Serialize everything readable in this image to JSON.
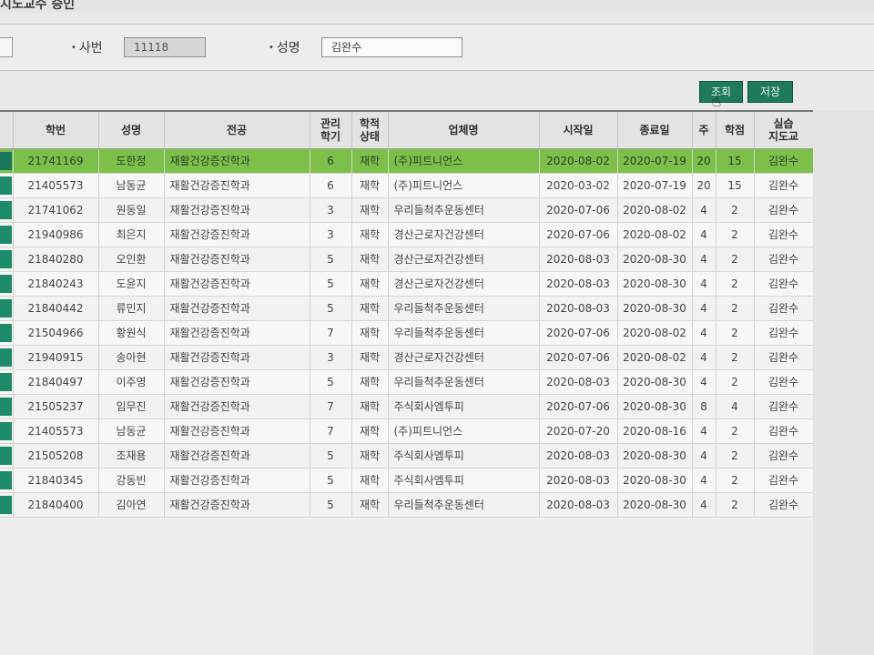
{
  "window": {
    "title": "지도교수 승인"
  },
  "search": {
    "id_label": "사번",
    "id_value": "11118",
    "name_label": "성명",
    "name_value": "김완수"
  },
  "toolbar": {
    "search_label": "조회",
    "save_label": "저장"
  },
  "colors": {
    "button": "#1e7a58",
    "selected_row": "#7cc04a",
    "indicator": "#1d8a6a"
  },
  "table": {
    "headers": {
      "student_id": "학번",
      "name": "성명",
      "major": "전공",
      "semester_1": "관리",
      "semester_2": "학기",
      "status_1": "학적",
      "status_2": "상태",
      "company": "업체명",
      "start": "시작일",
      "end": "종료일",
      "weeks": "주",
      "credits": "학점",
      "advisor_1": "실습",
      "advisor_2": "지도교"
    },
    "rows": [
      {
        "student_id": "21741169",
        "name": "도한정",
        "major": "재활건강증진학과",
        "semester": "6",
        "status": "재학",
        "company": "(주)피트니언스",
        "start": "2020-08-02",
        "end": "2020-07-19",
        "weeks": "20",
        "credits": "15",
        "advisor": "김완수"
      },
      {
        "student_id": "21405573",
        "name": "남동균",
        "major": "재활건강증진학과",
        "semester": "6",
        "status": "재학",
        "company": "(주)피트니언스",
        "start": "2020-03-02",
        "end": "2020-07-19",
        "weeks": "20",
        "credits": "15",
        "advisor": "김완수"
      },
      {
        "student_id": "21741062",
        "name": "원동일",
        "major": "재활건강증진학과",
        "semester": "3",
        "status": "재학",
        "company": "우리들척추운동센터",
        "start": "2020-07-06",
        "end": "2020-08-02",
        "weeks": "4",
        "credits": "2",
        "advisor": "김완수"
      },
      {
        "student_id": "21940986",
        "name": "최은지",
        "major": "재활건강증진학과",
        "semester": "3",
        "status": "재학",
        "company": "경산근로자건강센터",
        "start": "2020-07-06",
        "end": "2020-08-02",
        "weeks": "4",
        "credits": "2",
        "advisor": "김완수"
      },
      {
        "student_id": "21840280",
        "name": "오인환",
        "major": "재활건강증진학과",
        "semester": "5",
        "status": "재학",
        "company": "경산근로자건강센터",
        "start": "2020-08-03",
        "end": "2020-08-30",
        "weeks": "4",
        "credits": "2",
        "advisor": "김완수"
      },
      {
        "student_id": "21840243",
        "name": "도윤지",
        "major": "재활건강증진학과",
        "semester": "5",
        "status": "재학",
        "company": "경산근로자건강센터",
        "start": "2020-08-03",
        "end": "2020-08-30",
        "weeks": "4",
        "credits": "2",
        "advisor": "김완수"
      },
      {
        "student_id": "21840442",
        "name": "류민지",
        "major": "재활건강증진학과",
        "semester": "5",
        "status": "재학",
        "company": "우리들척추운동센터",
        "start": "2020-08-03",
        "end": "2020-08-30",
        "weeks": "4",
        "credits": "2",
        "advisor": "김완수"
      },
      {
        "student_id": "21504966",
        "name": "황원식",
        "major": "재활건강증진학과",
        "semester": "7",
        "status": "재학",
        "company": "우리들척추운동센터",
        "start": "2020-07-06",
        "end": "2020-08-02",
        "weeks": "4",
        "credits": "2",
        "advisor": "김완수"
      },
      {
        "student_id": "21940915",
        "name": "송아현",
        "major": "재활건강증진학과",
        "semester": "3",
        "status": "재학",
        "company": "경산근로자건강센터",
        "start": "2020-07-06",
        "end": "2020-08-02",
        "weeks": "4",
        "credits": "2",
        "advisor": "김완수"
      },
      {
        "student_id": "21840497",
        "name": "이주영",
        "major": "재활건강증진학과",
        "semester": "5",
        "status": "재학",
        "company": "우리들척추운동센터",
        "start": "2020-08-03",
        "end": "2020-08-30",
        "weeks": "4",
        "credits": "2",
        "advisor": "김완수"
      },
      {
        "student_id": "21505237",
        "name": "임무진",
        "major": "재활건강증진학과",
        "semester": "7",
        "status": "재학",
        "company": "주식회사엠투피",
        "start": "2020-07-06",
        "end": "2020-08-30",
        "weeks": "8",
        "credits": "4",
        "advisor": "김완수"
      },
      {
        "student_id": "21405573",
        "name": "남동균",
        "major": "재활건강증진학과",
        "semester": "7",
        "status": "재학",
        "company": "(주)피트니언스",
        "start": "2020-07-20",
        "end": "2020-08-16",
        "weeks": "4",
        "credits": "2",
        "advisor": "김완수"
      },
      {
        "student_id": "21505208",
        "name": "조재용",
        "major": "재활건강증진학과",
        "semester": "5",
        "status": "재학",
        "company": "주식회사엠투피",
        "start": "2020-08-03",
        "end": "2020-08-30",
        "weeks": "4",
        "credits": "2",
        "advisor": "김완수"
      },
      {
        "student_id": "21840345",
        "name": "강동빈",
        "major": "재활건강증진학과",
        "semester": "5",
        "status": "재학",
        "company": "주식회사엠투피",
        "start": "2020-08-03",
        "end": "2020-08-30",
        "weeks": "4",
        "credits": "2",
        "advisor": "김완수"
      },
      {
        "student_id": "21840400",
        "name": "김아연",
        "major": "재활건강증진학과",
        "semester": "5",
        "status": "재학",
        "company": "우리들척추운동센터",
        "start": "2020-08-03",
        "end": "2020-08-30",
        "weeks": "4",
        "credits": "2",
        "advisor": "김완수"
      }
    ],
    "selected_index": 0
  }
}
